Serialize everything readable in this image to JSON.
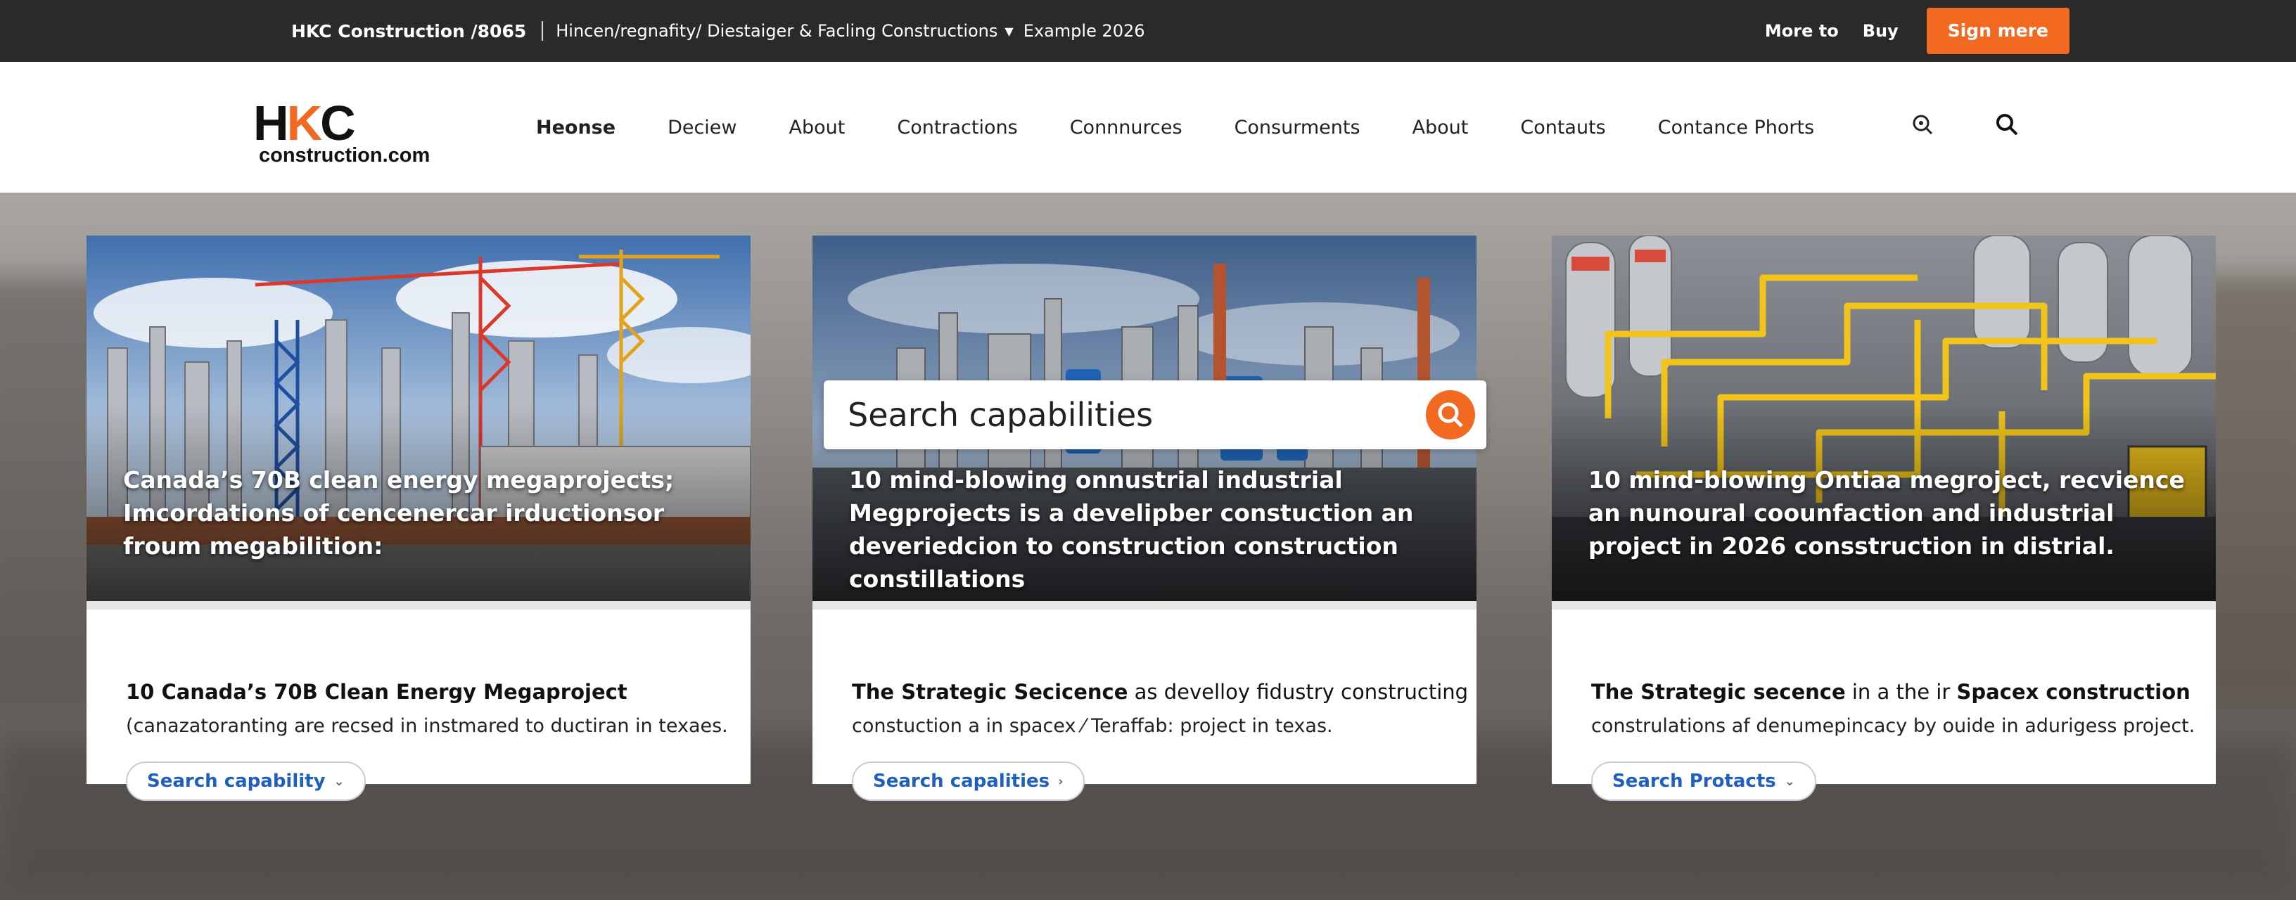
{
  "topbar": {
    "brand": "HKC Construction /8065",
    "crumb": "Hincen/regnafity/ Diestaiger & Facling Constructions",
    "example": "Example 2026",
    "links": [
      "More to",
      "Buy"
    ],
    "signin": "Sign mere"
  },
  "logo": {
    "line1_a": "H",
    "line1_b": "K",
    "line1_c": "C",
    "line2": "construction.com"
  },
  "nav": {
    "items": [
      "Heonse",
      "Deciew",
      "About",
      "Contractions",
      "Connnurces",
      "Consurments",
      "About",
      "Contauts",
      "Contance Phorts"
    ]
  },
  "icons": {
    "nav_search_1": "search-alt-icon",
    "nav_search_2": "search-icon",
    "search_go": "search-icon",
    "pill_chevron": "chevron-icon"
  },
  "search": {
    "placeholder": "Search capabilities"
  },
  "cards": [
    {
      "headline": "Canada’s 70B clean energy megaprojects; Imcordations of cencenercar irductionsor froum megabilition:",
      "title_bold": "10 Canada’s 70B Clean Energy Megaproject",
      "title_rest": "",
      "sub": "(canazatoranting are recsed in instmared to ductiran in texaes.",
      "pill": "Search capability",
      "pill_chev": "⌄"
    },
    {
      "headline": "10 mind-blowing onnustrial industrial Megprojects is a develipber constuction an deveriedcion to construction construction constillations",
      "title_bold": "The Strategic Secicence",
      "title_rest": " as develloy fidustry constructing",
      "sub": "constuction a in spacex ⁄ Teraffab: project in texas.",
      "pill": "Search capalities",
      "pill_chev": "›"
    },
    {
      "headline": "10 mind-blowing Ontiaa megroject, recvience an nunoural coounfaction and industrial project in 2026 consstruction in distrial.",
      "title_bold": "The Strategic secence",
      "title_rest": " in a the ir ",
      "title_bold2": "Spacex construction",
      "sub": "construlations af denumepincacy by ouide in adurigess project.",
      "pill": "Search Protacts",
      "pill_chev": "⌄"
    }
  ],
  "colors": {
    "accent": "#f26a21",
    "topbar": "#2a2a2a",
    "link": "#1f5fbf"
  }
}
